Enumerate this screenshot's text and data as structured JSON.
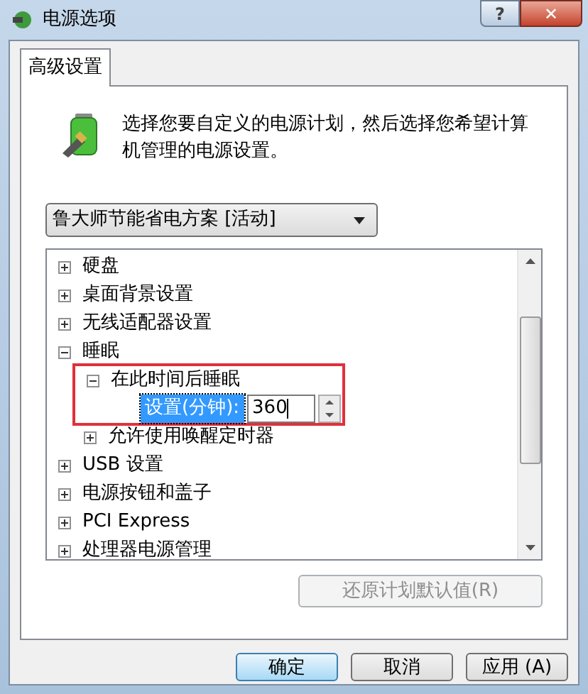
{
  "window": {
    "title": "电源选项",
    "help_button": "?",
    "close_button": "✕"
  },
  "tabs": [
    {
      "label": "高级设置",
      "selected": true
    }
  ],
  "description": "选择您要自定义的电源计划，然后选择您希望计算机管理的电源设置。",
  "plan_dropdown": {
    "value": "鲁大师节能省电方案 [活动]"
  },
  "tree": [
    {
      "label": "硬盘",
      "expanded": false
    },
    {
      "label": "桌面背景设置",
      "expanded": false
    },
    {
      "label": "无线适配器设置",
      "expanded": false
    },
    {
      "label": "睡眠",
      "expanded": true,
      "children": [
        {
          "label": "在此时间后睡眠",
          "expanded": true,
          "highlighted": true,
          "children": [
            {
              "kind": "setting",
              "label": "设置(分钟):",
              "value": "360",
              "selected": true
            }
          ]
        },
        {
          "label": "允许使用唤醒定时器",
          "expanded": false
        }
      ]
    },
    {
      "label": "USB 设置",
      "expanded": false
    },
    {
      "label": "电源按钮和盖子",
      "expanded": false
    },
    {
      "label": "PCI Express",
      "expanded": false
    },
    {
      "label": "处理器电源管理",
      "expanded": false
    }
  ],
  "restore_button": {
    "label": "还原计划默认值(R)",
    "disabled": true
  },
  "buttons": [
    {
      "label": "确定",
      "selected": true
    },
    {
      "label": "取消",
      "selected": false
    },
    {
      "label": "应用 (A)",
      "selected": false
    }
  ]
}
